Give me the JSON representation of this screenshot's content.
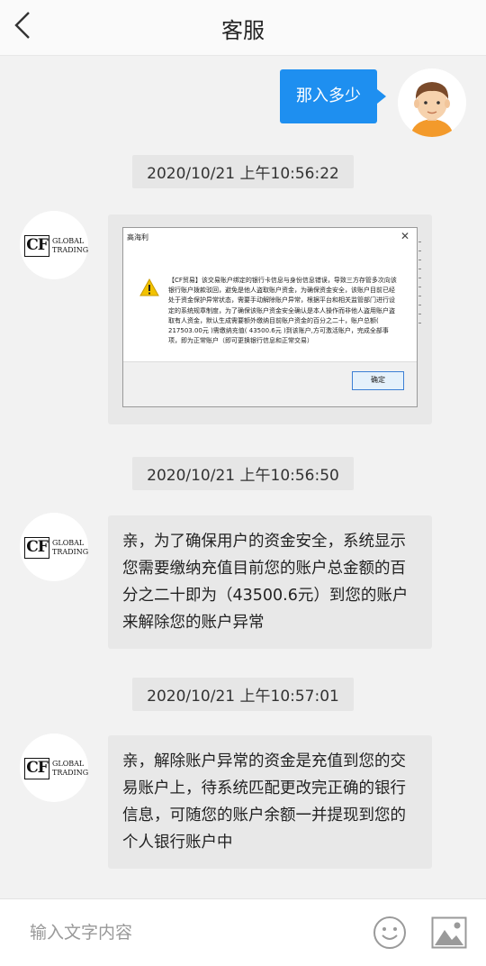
{
  "header": {
    "title": "客服"
  },
  "messages": {
    "m1": {
      "text": "那入多少"
    },
    "t1": "2020/10/21 上午10:56:22",
    "image": {
      "dialog_title": "高海利",
      "dialog_close": "✕",
      "dialog_message": "【CF贸易】该交易账户绑定的银行卡信息与身份信息错误，导致三方存管多次向该银行账户拨款驳回，避免是他人盗取账户资金，为确保资金安全，该账户目前已经处于资金保护异常状态，需要手动解除账户异常，根据平台和相关监管部门进行设定的系统规章制度，为了确保该账户资金安全确认是本人操作而非他人盗用账户盗取有人资金，默认生成需要额外缴纳目前账户资金的百分之二十，账户总额( 217503.00元 )需缴纳充值( 43500.6元 )到该账户,方可激活账户，完成全部事项，即为正常账户（即可更换银行信息和正常交易）",
      "dialog_ok": "确定"
    },
    "t2": "2020/10/21 上午10:56:50",
    "m2": {
      "text": "亲，为了确保用户的资金安全，系统显示您需要缴纳充值目前您的账户总金额的百分之二十即为（43500.6元）到您的账户来解除您的账户异常"
    },
    "t3": "2020/10/21 上午10:57:01",
    "m3": {
      "text": "亲，解除账户异常的资金是充值到您的交易账户上，待系统匹配更改完正确的银行信息，可随您的账户余额一并提现到您的个人银行账户中"
    }
  },
  "agent": {
    "logo_letters": "CF",
    "logo_line1": "GLOBAL",
    "logo_line2": "TRADING"
  },
  "composer": {
    "placeholder": "输入文字内容"
  },
  "icons": {
    "back": "chevron-left-icon",
    "emoji": "smiley-icon",
    "image": "image-icon",
    "warning": "warning-icon"
  },
  "colors": {
    "accent": "#1e8ff0",
    "bubble_in": "#e8e8e8",
    "background": "#f2f2f2"
  }
}
